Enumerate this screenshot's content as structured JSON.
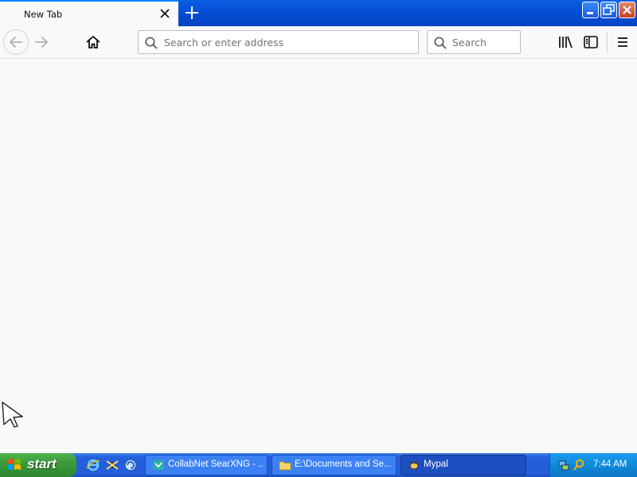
{
  "browser": {
    "tab": {
      "title": "New Tab"
    },
    "urlbar": {
      "placeholder": "Search or enter address",
      "value": ""
    },
    "searchbar": {
      "placeholder": "Search",
      "value": ""
    }
  },
  "taskbar": {
    "start_label": "start",
    "quick_launch": [
      "internet-explorer-icon",
      "media-icon",
      "browser-icon"
    ],
    "tasks": [
      {
        "label": "CollabNet SearXNG - ...",
        "icon": "app-icon",
        "active": false
      },
      {
        "label": "E:\\Documents and Se...",
        "icon": "folder-icon",
        "active": false
      },
      {
        "label": "Mypal",
        "icon": "mypal-icon",
        "active": true
      }
    ],
    "clock": "7:44 AM"
  },
  "colors": {
    "titlebar": "#0550d8",
    "tab_accent": "#0a84ff",
    "page_bg": "#f9f9fa",
    "start_green": "#3c9c3c",
    "taskbar_blue": "#245edb"
  }
}
